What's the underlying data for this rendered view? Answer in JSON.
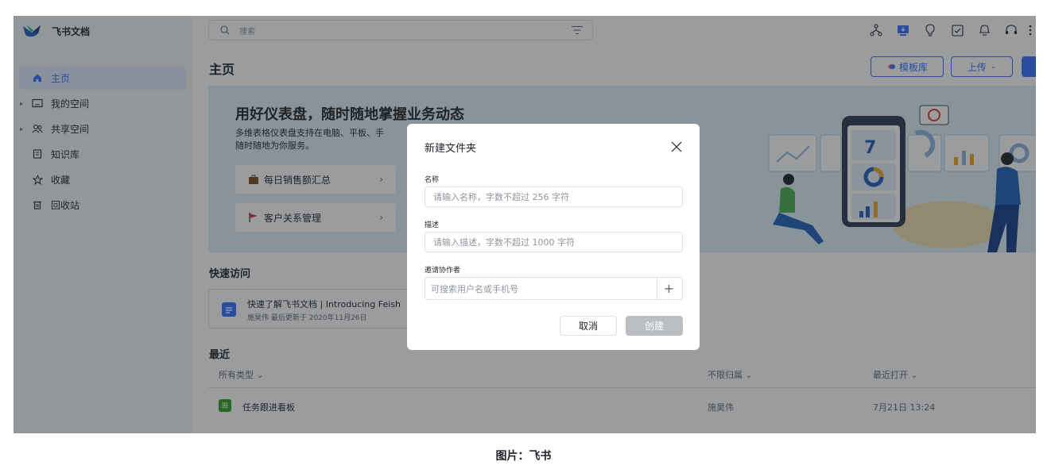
{
  "app": {
    "name": "飞书文档"
  },
  "sidebar": {
    "items": [
      {
        "label": "主页",
        "icon": "home-icon",
        "active": true
      },
      {
        "label": "我的空间",
        "icon": "folder-icon",
        "expandable": true
      },
      {
        "label": "共享空间",
        "icon": "people-icon",
        "expandable": true
      },
      {
        "label": "知识库",
        "icon": "book-icon"
      },
      {
        "label": "收藏",
        "icon": "star-icon"
      },
      {
        "label": "回收站",
        "icon": "trash-icon"
      }
    ]
  },
  "header": {
    "search_placeholder": "搜索",
    "icons": [
      "org-chart-icon",
      "download-icon",
      "bulb-icon",
      "checkbox-icon",
      "bell-icon",
      "headset-icon",
      "more-icon"
    ]
  },
  "main": {
    "title": "主页",
    "template_button": "模板库",
    "upload_button": "上传",
    "banner": {
      "title": "用好仪表盘，随时随地掌握业务动态",
      "desc_line1": "多维表格仪表盘支持在电脑、平板、手",
      "desc_line2": "随时随地为你服务。",
      "card1": "每日销售额汇总",
      "card2": "客户关系管理"
    },
    "quick_access": {
      "title": "快速访问",
      "doc_title": "快速了解飞书文档 | Introducing Feish",
      "doc_meta": "施昊伟 最后更新于 2020年11月26日"
    },
    "recent": {
      "title": "最近",
      "columns": {
        "type": "所有类型",
        "owner": "不限归属",
        "opened": "最近打开"
      },
      "rows": [
        {
          "name": "任务跟进看板",
          "owner": "施昊伟",
          "opened": "7月21日 13:24"
        }
      ]
    }
  },
  "dialog": {
    "title": "新建文件夹",
    "name_label": "名称",
    "name_placeholder": "请输入名称，字数不超过 256 字符",
    "desc_label": "描述",
    "desc_placeholder": "请输入描述，字数不超过 1000 字符",
    "invite_label": "邀请协作者",
    "invite_placeholder": "可搜索用户名或手机号",
    "cancel": "取消",
    "create": "创建"
  },
  "caption": "图片：飞书",
  "colors": {
    "accent": "#3370ff",
    "banner_bg": "#dff0f7",
    "sidebar_bg": "#f5f6f7",
    "overlay": "#1f2329"
  }
}
